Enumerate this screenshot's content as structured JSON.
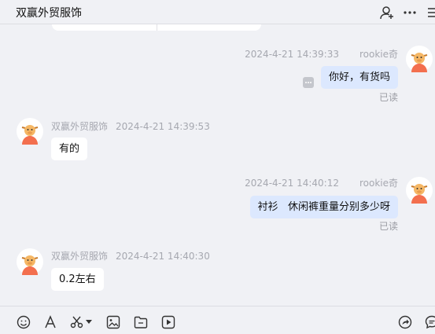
{
  "header": {
    "title": "双赢外贸服饰",
    "icons": [
      "add-member-icon",
      "more-icon",
      "menu-icon"
    ]
  },
  "messages": [
    {
      "direction": "out",
      "sender": "rookie奇",
      "time": "2024-4-21 14:39:33",
      "text": "你好，有货吗",
      "status": "已读"
    },
    {
      "direction": "in",
      "sender": "双赢外贸服饰",
      "time": "2024-4-21 14:39:53",
      "text": "有的"
    },
    {
      "direction": "out",
      "sender": "rookie奇",
      "time": "2024-4-21 14:40:12",
      "text": "衬衫   休闲裤重量分别多少呀",
      "status": "已读"
    },
    {
      "direction": "in",
      "sender": "双赢外贸服饰",
      "time": "2024-4-21 14:40:30",
      "text": "0.2左右"
    }
  ],
  "toolbar": {
    "icons": [
      "emoji-icon",
      "font-icon",
      "scissors-icon",
      "image-icon",
      "folder-icon",
      "video-icon",
      "share-icon",
      "chat-icon"
    ]
  }
}
